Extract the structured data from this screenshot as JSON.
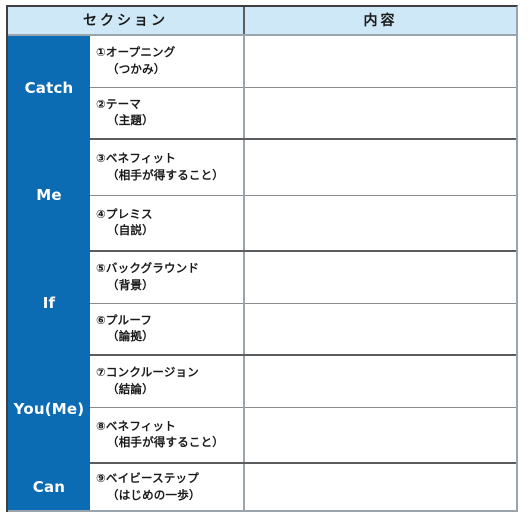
{
  "table": {
    "headers": {
      "section": "セクション",
      "content": "内容"
    },
    "colors": {
      "header_bg": "#cfe8f7",
      "section_bg": "#0b6cb4",
      "section_text": "#ffffff",
      "border_dark": "#5c5c5c",
      "border_light": "#9aa4ad",
      "body_text": "#1a1a1a"
    },
    "groups": [
      {
        "label": "Catch",
        "rows": [
          {
            "line1": "①オープニング",
            "line2": "（つかみ）",
            "content": ""
          },
          {
            "line1": "②テーマ",
            "line2": "（主題）",
            "content": ""
          }
        ]
      },
      {
        "label": "Me",
        "rows": [
          {
            "line1": "③ベネフィット",
            "line2": "（相手が得すること）",
            "content": ""
          },
          {
            "line1": "④プレミス",
            "line2": "（自説）",
            "content": ""
          }
        ]
      },
      {
        "label": "If",
        "rows": [
          {
            "line1": "⑤バックグラウンド",
            "line2": "（背景）",
            "content": ""
          },
          {
            "line1": "⑥プルーフ",
            "line2": "（論拠）",
            "content": ""
          }
        ]
      },
      {
        "label": "You(Me)",
        "rows": [
          {
            "line1": "⑦コンクルージョン",
            "line2": "（結論）",
            "content": ""
          },
          {
            "line1": "⑧ベネフィット",
            "line2": "（相手が得すること）",
            "content": ""
          }
        ]
      },
      {
        "label": "Can",
        "rows": [
          {
            "line1": "⑨ベイビーステップ",
            "line2": "（はじめの一歩）",
            "content": ""
          }
        ]
      }
    ]
  }
}
